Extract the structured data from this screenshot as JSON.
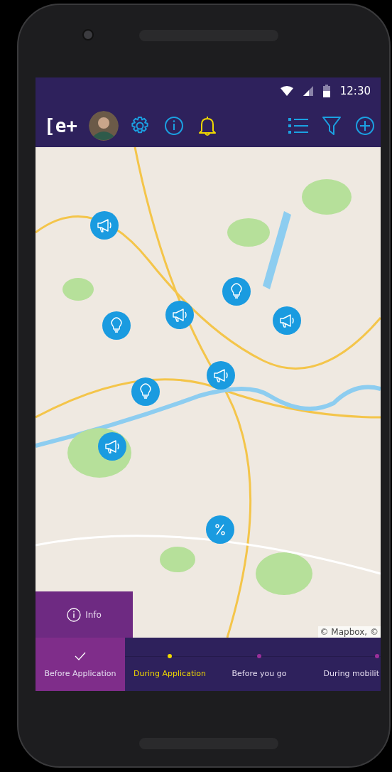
{
  "status_bar": {
    "time": "12:30"
  },
  "toolbar": {
    "left": [
      {
        "kind": "logo",
        "label": "[e+"
      },
      {
        "kind": "avatar"
      },
      {
        "kind": "settings"
      },
      {
        "kind": "info"
      },
      {
        "kind": "bell"
      }
    ],
    "right": [
      {
        "kind": "list"
      },
      {
        "kind": "filter"
      },
      {
        "kind": "add"
      }
    ]
  },
  "map": {
    "attribution": "© Mapbox, ©",
    "markers": [
      {
        "kind": "megaphone"
      },
      {
        "kind": "bulb"
      },
      {
        "kind": "megaphone"
      },
      {
        "kind": "megaphone"
      },
      {
        "kind": "bulb"
      },
      {
        "kind": "megaphone"
      },
      {
        "kind": "bulb"
      },
      {
        "kind": "megaphone"
      },
      {
        "kind": "percent"
      }
    ]
  },
  "info_button": {
    "label": "Info"
  },
  "steps": [
    {
      "label": "Before Application",
      "kind": "done",
      "selected": true
    },
    {
      "label": "During Application",
      "kind": "current",
      "selected": false
    },
    {
      "label": "Before you go",
      "kind": "upcoming",
      "selected": false
    },
    {
      "label": "During mobilit",
      "kind": "upcoming",
      "selected": false
    }
  ]
}
